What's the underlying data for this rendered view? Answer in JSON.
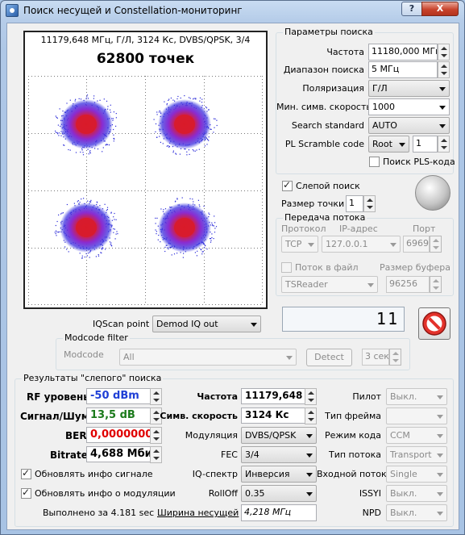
{
  "window": {
    "title": "Поиск несущей и Constellation-мониторинг",
    "help_label": "?",
    "close_label": "X"
  },
  "plot": {
    "info": "11179,648 МГц, Г/Л, 3124 Кс, DVBS/QPSK, 3/4",
    "points_label": "62800 точек"
  },
  "search_params": {
    "title": "Параметры поиска",
    "frequency_label": "Частота",
    "frequency_value": "11180,000 МГц",
    "range_label": "Диапазон поиска",
    "range_value": "5 МГц",
    "polarization_label": "Поляризация",
    "polarization_value": "Г/Л",
    "min_sr_label": "Мин. симв. скорость",
    "min_sr_value": "1000",
    "standard_label": "Search standard",
    "standard_value": "AUTO",
    "pls_label": "PL Scramble code",
    "pls_mode": "Root",
    "pls_value": "1",
    "pls_search_label": "Поиск PLS-кода"
  },
  "blind": {
    "blind_label": "Слепой поиск",
    "point_size_label": "Размер точки",
    "point_size_value": "1"
  },
  "stream": {
    "title": "Передача потока",
    "protocol_label": "Протокол",
    "ip_label": "IP-адрес",
    "port_label": "Порт",
    "protocol_value": "TCP",
    "ip_value": "127.0.0.1",
    "port_value": "6969",
    "to_file_label": "Поток в файл",
    "buffer_label": "Размер буфера",
    "reader_value": "TSReader",
    "buffer_value": "96256"
  },
  "iq": {
    "scan_label": "IQScan point",
    "scan_value": "Demod IQ out",
    "lcd_value": "11"
  },
  "modcode": {
    "title": "Modcode filter",
    "label": "Modcode",
    "value": "All",
    "detect_label": "Detect",
    "time_value": "3 сек"
  },
  "results": {
    "title": "Результаты \"слепого\" поиска",
    "rf_label": "RF уровень",
    "rf_value": "-50 dBm",
    "snr_label": "Сигнал/Шум",
    "snr_value": "13,5 dB",
    "ber_label": "BER",
    "ber_value": "0,0000000",
    "bitrate_label": "Bitrate",
    "bitrate_value": "4,688 Мбит",
    "freq_label": "Частота",
    "freq_value": "11179,648 MI",
    "sr_label": "Симв. скорость",
    "sr_value": "3124 Кс",
    "mod_label": "Модуляция",
    "mod_value": "DVBS/QPSK",
    "fec_label": "FEC",
    "fec_value": "3/4",
    "iq_label": "IQ-спектр",
    "iq_value": "Инверсия",
    "rolloff_label": "RollOff",
    "rolloff_value": "0.35",
    "bandwidth_label": "Ширина несущей",
    "bandwidth_value": "4,218 МГц",
    "pilot_label": "Пилот",
    "pilot_value": "Выкл.",
    "frame_label": "Тип фрейма",
    "frame_value": "",
    "code_mode_label": "Режим кода",
    "code_mode_value": "CCM",
    "stream_type_label": "Тип потока",
    "stream_type_value": "Transport",
    "input_label": "Входной поток",
    "input_value": "Single",
    "issyi_label": "ISSYI",
    "issyi_value": "Выкл.",
    "npd_label": "NPD",
    "npd_value": "Выкл.",
    "update_signal_label": "Обновлять инфо сигнале",
    "update_mod_label": "Обновлять инфо о модуляции",
    "elapsed": "Выполнено за 4.181 sec"
  },
  "colors": {
    "cluster_core": "#d81b2a",
    "cluster_mid": "#7a2ad0",
    "cluster_edge": "#2a2ad8"
  }
}
